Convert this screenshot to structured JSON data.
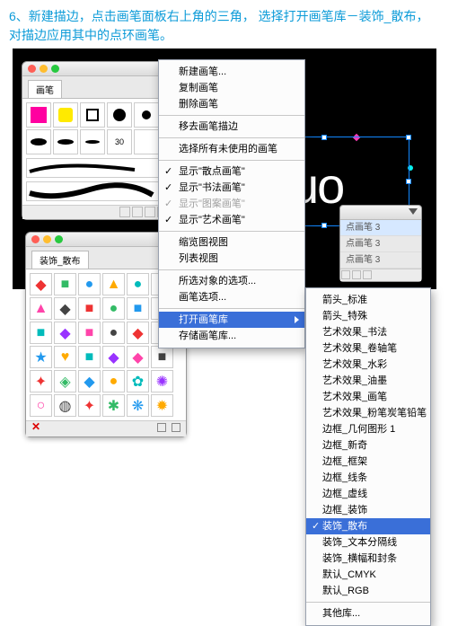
{
  "step_text": "6、新建描边，点击画笔面板右上角的三角，\n选择打开画笔库－装饰_散布，对描边应用其中的点环画笔。",
  "canvas_text": "uo",
  "panel_brush": {
    "tab": "画笔",
    "stroke_value": "30"
  },
  "panel_deco": {
    "tab": "装饰_散布"
  },
  "right_panel": {
    "items": [
      "点画笔 3",
      "点画笔 3",
      "点画笔 3"
    ],
    "selected": 0
  },
  "menu": {
    "items": [
      {
        "label": "新建画笔..."
      },
      {
        "label": "复制画笔"
      },
      {
        "label": "删除画笔"
      },
      {
        "sep": true
      },
      {
        "label": "移去画笔描边"
      },
      {
        "sep": true
      },
      {
        "label": "选择所有未使用的画笔"
      },
      {
        "sep": true
      },
      {
        "label": "显示\"散点画笔\"",
        "checked": true
      },
      {
        "label": "显示\"书法画笔\"",
        "checked": true
      },
      {
        "label": "显示\"图案画笔\"",
        "checked": true,
        "disabled": true
      },
      {
        "label": "显示\"艺术画笔\"",
        "checked": true
      },
      {
        "sep": true
      },
      {
        "label": "缩览图视图"
      },
      {
        "label": "列表视图"
      },
      {
        "sep": true
      },
      {
        "label": "所选对象的选项..."
      },
      {
        "label": "画笔选项..."
      },
      {
        "sep": true
      },
      {
        "label": "打开画笔库",
        "selected": true,
        "submenu": true
      },
      {
        "label": "存储画笔库..."
      }
    ]
  },
  "submenu": {
    "items": [
      {
        "label": "箭头_标准"
      },
      {
        "label": "箭头_特殊"
      },
      {
        "label": "艺术效果_书法"
      },
      {
        "label": "艺术效果_卷轴笔"
      },
      {
        "label": "艺术效果_水彩"
      },
      {
        "label": "艺术效果_油墨"
      },
      {
        "label": "艺术效果_画笔"
      },
      {
        "label": "艺术效果_粉笔炭笔铅笔"
      },
      {
        "label": "边框_几何图形 1"
      },
      {
        "label": "边框_新奇"
      },
      {
        "label": "边框_框架"
      },
      {
        "label": "边框_线条"
      },
      {
        "label": "边框_虚线"
      },
      {
        "label": "边框_装饰"
      },
      {
        "label": "装饰_散布",
        "selected": true,
        "checked": true
      },
      {
        "label": "装饰_文本分隔线"
      },
      {
        "label": "装饰_横幅和封条"
      },
      {
        "label": "默认_CMYK"
      },
      {
        "label": "默认_RGB"
      },
      {
        "sep": true
      },
      {
        "label": "其他库..."
      }
    ]
  }
}
